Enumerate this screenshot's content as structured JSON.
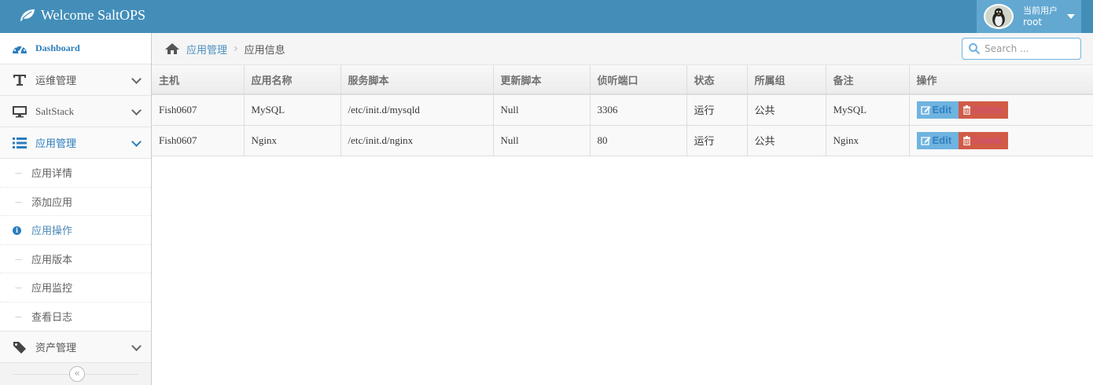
{
  "navbar": {
    "brand": "Welcome SaltOPS",
    "user_label": "当前用户",
    "user_name": "root"
  },
  "sidebar": {
    "items": [
      {
        "label": "Dashboard",
        "icon": "tachometer-icon"
      },
      {
        "label": "运维管理",
        "icon": "text-t-icon"
      },
      {
        "label": "SaltStack",
        "icon": "desktop-icon"
      },
      {
        "label": "应用管理",
        "icon": "list-icon"
      },
      {
        "label": "资产管理",
        "icon": "tag-icon"
      }
    ],
    "sub_items": [
      {
        "label": "应用详情"
      },
      {
        "label": "添加应用"
      },
      {
        "label": "应用操作"
      },
      {
        "label": "应用版本"
      },
      {
        "label": "应用监控"
      },
      {
        "label": "查看日志"
      }
    ],
    "collapse_glyph": "«"
  },
  "breadcrumb": {
    "parent": "应用管理",
    "separator": "›",
    "current": "应用信息"
  },
  "search": {
    "placeholder": "Search ..."
  },
  "table": {
    "headers": [
      "主机",
      "应用名称",
      "服务脚本",
      "更新脚本",
      "侦听端口",
      "状态",
      "所属组",
      "备注",
      "操作"
    ],
    "rows": [
      {
        "host": "Fish0607",
        "name": "MySQL",
        "service_script": "/etc/init.d/mysqld",
        "update_script": "Null",
        "port": "3306",
        "status": "运行",
        "group": "公共",
        "note": "MySQL"
      },
      {
        "host": "Fish0607",
        "name": "Nginx",
        "service_script": "/etc/init.d/nginx",
        "update_script": "Null",
        "port": "80",
        "status": "运行",
        "group": "公共",
        "note": "Nginx"
      }
    ],
    "edit_label": "Edit",
    "delete_label": "Delete"
  },
  "colors": {
    "navbar": "#438eb9",
    "user_box": "#62a8d1",
    "active": "#2b7dbc",
    "edit_button": "#6fb3e0",
    "delete_button": "#d15b47"
  }
}
